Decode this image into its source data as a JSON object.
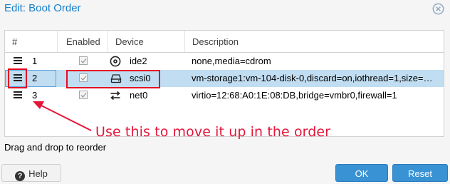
{
  "dialog": {
    "title": "Edit: Boot Order",
    "close_icon": "close-circle-icon"
  },
  "grid": {
    "columns": [
      "#",
      "Enabled",
      "Device",
      "Description"
    ],
    "rows": [
      {
        "order": "1",
        "enabled": true,
        "device": "ide2",
        "device_icon": "cdrom-icon",
        "description": "none,media=cdrom",
        "selected": false
      },
      {
        "order": "2",
        "enabled": true,
        "device": "scsi0",
        "device_icon": "hard-disk-icon",
        "description": "vm-storage1:vm-104-disk-0,discard=on,iothread=1,size=…",
        "selected": true
      },
      {
        "order": "3",
        "enabled": true,
        "device": "net0",
        "device_icon": "network-exchange-icon",
        "description": "virtio=12:68:A0:1E:08:DB,bridge=vmbr0,firewall=1",
        "selected": false
      }
    ]
  },
  "annotation": {
    "text": "Use this to move it up in the order",
    "color": "#e4163a"
  },
  "hint": "Drag and drop to reorder",
  "footer": {
    "help_label": "Help",
    "ok_label": "OK",
    "reset_label": "Reset"
  },
  "colors": {
    "accent": "#157fcc",
    "primary_button": "#3892d4",
    "selected_row": "#c1ddf1",
    "highlight_red": "#e30a22"
  }
}
